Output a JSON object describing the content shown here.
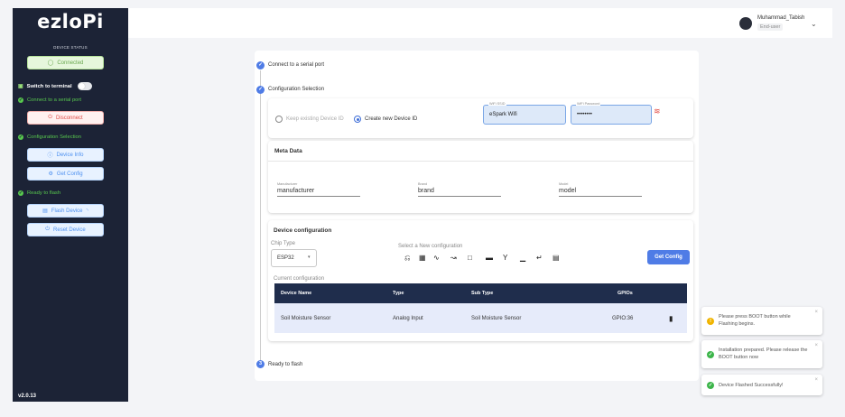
{
  "sidebar": {
    "logo": "ezloPi",
    "device_status_label": "DEVICE STATUS",
    "connected_label": "Connected",
    "switch_terminal_label": "Switch to terminal",
    "step_serial_label": "Connect to a serial port",
    "disconnect_label": "Disconnect",
    "step_config_label": "Configuration Selection",
    "device_info_label": "Device Info",
    "get_config_label": "Get Config",
    "step_ready_label": "Ready to flash",
    "flash_device_label": "Flash Device",
    "reset_device_label": "Reset Device",
    "version": "v2.0.13"
  },
  "header": {
    "user_name": "Muhammad_Tabish",
    "user_role": "End-user"
  },
  "stepper": {
    "step1_label": "Connect to a serial port",
    "step2_label": "Configuration Selection",
    "step3_number": "3",
    "step3_label": "Ready to flash"
  },
  "device_id": {
    "keep_existing_label": "Keep existing Device ID",
    "create_new_label": "Create new Device ID",
    "selected": "create_new",
    "wifi_ssid_label": "WiFi SSID",
    "wifi_ssid_value": "eSpark Wifi",
    "wifi_password_label": "WiFi Password",
    "wifi_password_value": "••••••••"
  },
  "meta_data": {
    "title": "Meta Data",
    "manufacturer_label": "Manufacturer",
    "manufacturer_value": "manufacturer",
    "brand_label": "Brand",
    "brand_value": "brand",
    "model_label": "Model",
    "model_value": "model"
  },
  "device_configuration": {
    "title": "Device configuration",
    "chip_type_label": "Chip Type",
    "chip_type_value": "ESP32",
    "select_new_label": "Select a New configuration",
    "get_config_button": "Get Config",
    "current_config_label": "Current configuration",
    "icons": [
      "digital-output-icon",
      "digital-input-icon",
      "pwm-icon",
      "analog-input-icon",
      "uart-icon",
      "onewire-icon",
      "i2c-icon",
      "spi-icon",
      "other-icon"
    ],
    "table": {
      "columns": [
        "Device Name",
        "Type",
        "Sub Type",
        "GPIOs"
      ],
      "rows": [
        {
          "device_name": "Soil Moisture Sensor",
          "type": "Analog Input",
          "sub_type": "Soil Moisture Sensor",
          "gpios": "GPIO:36"
        }
      ]
    }
  },
  "toasts": [
    {
      "kind": "warning",
      "text": "Please press BOOT button while Flashing begins."
    },
    {
      "kind": "success",
      "text": "Installation prepared. Please release the BOOT button now"
    },
    {
      "kind": "success",
      "text": "Device Flashed Successfully!"
    }
  ],
  "colors": {
    "sidebar_bg": "#1c2336",
    "accent": "#4f7ce6",
    "success": "#58c84e",
    "warning": "#f0b400",
    "table_header": "#1f2d4c"
  }
}
